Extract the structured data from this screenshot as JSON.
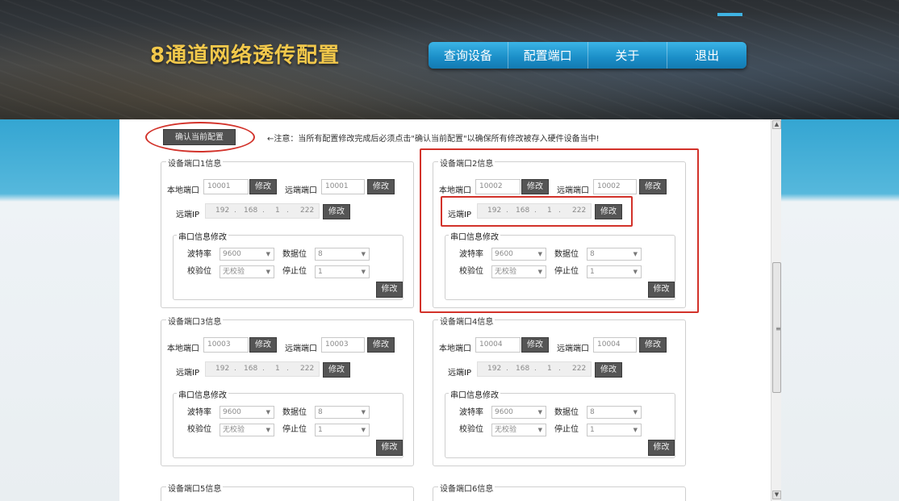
{
  "header": {
    "title": "8通道网络透传配置",
    "nav": [
      "查询设备",
      "配置端口",
      "关于",
      "退出"
    ]
  },
  "toolbar": {
    "confirm_label": "确认当前配置",
    "notice": "←注意：当所有配置修改完成后必须点击\"确认当前配置\"以确保所有修改被存入硬件设备当中!"
  },
  "labels": {
    "local_port": "本地端口",
    "remote_port": "远端端口",
    "remote_ip": "远端IP",
    "modify": "修改",
    "serial_section": "串口信息修改",
    "baud": "波特率",
    "data_bits": "数据位",
    "parity": "校验位",
    "stop_bits": "停止位"
  },
  "ports": [
    {
      "title": "设备端口1信息",
      "local_port": "10001",
      "remote_port": "10001",
      "ip": [
        "192",
        "168",
        "1",
        "222"
      ],
      "baud": "9600",
      "data_bits": "8",
      "parity": "无校验",
      "stop_bits": "1"
    },
    {
      "title": "设备端口2信息",
      "local_port": "10002",
      "remote_port": "10002",
      "ip": [
        "192",
        "168",
        "1",
        "222"
      ],
      "baud": "9600",
      "data_bits": "8",
      "parity": "无校验",
      "stop_bits": "1"
    },
    {
      "title": "设备端口3信息",
      "local_port": "10003",
      "remote_port": "10003",
      "ip": [
        "192",
        "168",
        "1",
        "222"
      ],
      "baud": "9600",
      "data_bits": "8",
      "parity": "无校验",
      "stop_bits": "1"
    },
    {
      "title": "设备端口4信息",
      "local_port": "10004",
      "remote_port": "10004",
      "ip": [
        "192",
        "168",
        "1",
        "222"
      ],
      "baud": "9600",
      "data_bits": "8",
      "parity": "无校验",
      "stop_bits": "1"
    },
    {
      "title": "设备端口5信息"
    },
    {
      "title": "设备端口6信息"
    }
  ],
  "colors": {
    "title_gold": "#f2c84b",
    "nav_blue": "#1a8dc7",
    "highlight_red": "#d2322a",
    "button_dark": "#555555"
  }
}
